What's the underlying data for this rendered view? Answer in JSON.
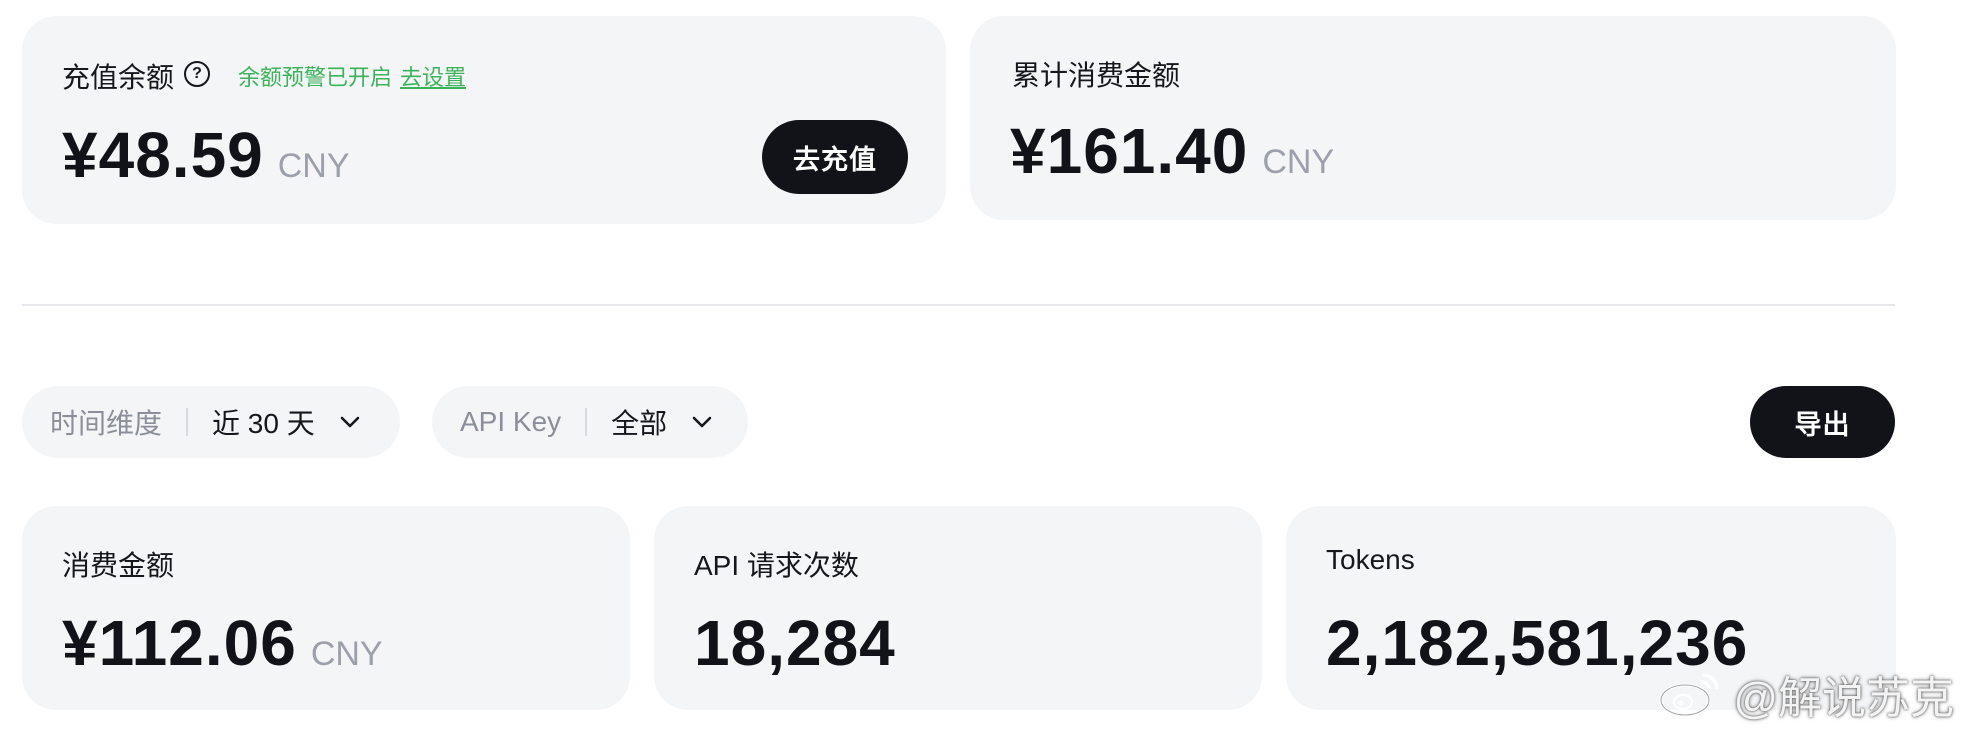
{
  "balance_card": {
    "label": "充值余额",
    "help_icon": "?",
    "alert_text": "余额预警已开启",
    "alert_link": "去设置",
    "amount": "¥48.59",
    "unit": "CNY",
    "recharge_button": "去充值"
  },
  "total_spend_card": {
    "label": "累计消费金额",
    "amount": "¥161.40",
    "unit": "CNY"
  },
  "filters": {
    "time": {
      "label": "时间维度",
      "value": "近 30 天"
    },
    "api_key": {
      "label": "API Key",
      "value": "全部"
    },
    "export_button": "导出"
  },
  "stats": {
    "spend": {
      "label": "消费金额",
      "amount": "¥112.06",
      "unit": "CNY"
    },
    "requests": {
      "label": "API 请求次数",
      "value": "18,284"
    },
    "tokens": {
      "label": "Tokens",
      "value": "2,182,581,236"
    }
  },
  "watermark": {
    "text": "@解说苏克",
    "icon": "weibo-icon"
  },
  "colors": {
    "accent_green": "#3bb35a",
    "dark_button": "#111318",
    "card_bg": "#f4f5f7"
  }
}
